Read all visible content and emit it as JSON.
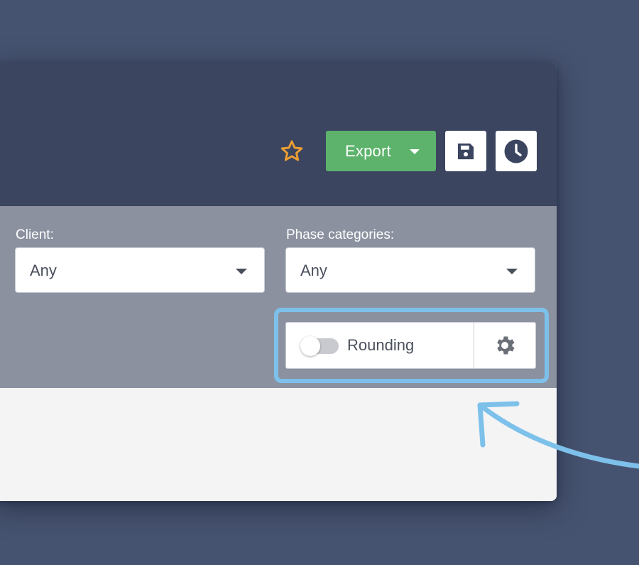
{
  "toolbar": {
    "export_label": "Export",
    "icons": {
      "favorite": "star-icon",
      "save": "floppy-disk-icon",
      "history": "clock-icon",
      "export_dropdown": "caret-down-icon"
    }
  },
  "filters": {
    "client": {
      "label": "Client:",
      "value": "Any"
    },
    "phase_categories": {
      "label": "Phase categories:",
      "value": "Any"
    }
  },
  "rounding": {
    "label": "Rounding",
    "enabled": false,
    "settings_icon": "gear-icon"
  },
  "annotation": {
    "highlight": "rounding-control",
    "arrow": "curved-arrow-icon"
  },
  "colors": {
    "background": "#465370",
    "header": "#3b4560",
    "filter_bar": "#8b919f",
    "content": "#f4f4f5",
    "export_green": "#5db36b",
    "star_orange": "#f0a030",
    "highlight_blue": "#7dc1eb",
    "icon_dark": "#3b4560"
  }
}
